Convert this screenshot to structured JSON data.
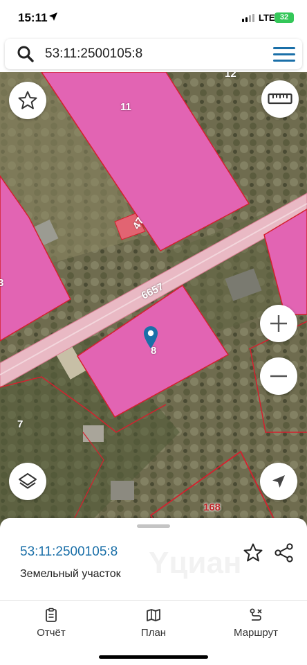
{
  "status_bar": {
    "time": "15:11",
    "network": "LTE",
    "battery": "32"
  },
  "search": {
    "value": "53:11:2500105:8",
    "placeholder": ""
  },
  "map": {
    "parcel_labels": {
      "p11": "11",
      "p47": "47",
      "p8": "8",
      "p7": "7",
      "p168": "168",
      "p12": "12",
      "p3": "3"
    },
    "road_label": "6657",
    "colors": {
      "parcel_fill": "#e264b3",
      "parcel_border": "#d4202e",
      "road": "#e9b9c4",
      "accent": "#1a6fa8"
    }
  },
  "sheet": {
    "cadastral_number": "53:11:2500105:8",
    "parcel_type": "Земельный участок",
    "watermark": "Yциан"
  },
  "nav": {
    "report": "Отчёт",
    "plan": "План",
    "route": "Маршрут"
  },
  "icons": {
    "search": "search-icon",
    "menu": "hamburger-menu-icon",
    "favorite": "star-icon",
    "ruler": "ruler-icon",
    "zoom_in": "plus-icon",
    "zoom_out": "minus-icon",
    "layers": "layers-icon",
    "locate": "navigation-arrow-icon",
    "share": "share-icon"
  }
}
